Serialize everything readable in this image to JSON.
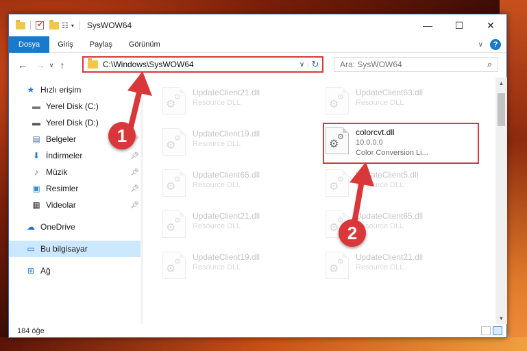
{
  "window": {
    "title": "SysWOW64",
    "controls": {
      "minimize": "—",
      "maximize": "☐",
      "close": "✕"
    }
  },
  "ribbon": {
    "tabs": [
      "Dosya",
      "Giriş",
      "Paylaş",
      "Görünüm"
    ],
    "active_tab": "Dosya",
    "help_label": "?"
  },
  "address": {
    "path": "C:\\Windows\\SysWOW64",
    "search_placeholder": "Ara: SysWOW64"
  },
  "nav": {
    "items": [
      {
        "label": "Hızlı erişim",
        "icon": "star-icon",
        "pinned": false
      },
      {
        "label": "Yerel Disk (C:)",
        "icon": "drive-icon",
        "pinned": false
      },
      {
        "label": "Yerel Disk (D:)",
        "icon": "drive-icon",
        "pinned": false
      },
      {
        "label": "Belgeler",
        "icon": "documents-icon",
        "pinned": true
      },
      {
        "label": "İndirmeler",
        "icon": "download-icon",
        "pinned": true
      },
      {
        "label": "Müzik",
        "icon": "music-icon",
        "pinned": true
      },
      {
        "label": "Resimler",
        "icon": "pictures-icon",
        "pinned": true
      },
      {
        "label": "Videolar",
        "icon": "videos-icon",
        "pinned": true
      },
      {
        "label": "OneDrive",
        "icon": "onedrive-icon",
        "pinned": false
      },
      {
        "label": "Bu bilgisayar",
        "icon": "computer-icon",
        "pinned": false
      },
      {
        "label": "Ağ",
        "icon": "network-icon",
        "pinned": false
      }
    ],
    "selected": "Bu bilgisayar"
  },
  "files": [
    {
      "name": "UpdateClient21.dll",
      "sub1": "Resource DLL",
      "sub2": "",
      "faded": true
    },
    {
      "name": "UpdateClient63.dll",
      "sub1": "Resource DLL",
      "sub2": "",
      "faded": true
    },
    {
      "name": "UpdateClient19.dll",
      "sub1": "Resource DLL",
      "sub2": "",
      "faded": true
    },
    {
      "name": "colorcvt.dll",
      "sub1": "10.0.0.0",
      "sub2": "Color Conversion Li...",
      "faded": false
    },
    {
      "name": "UpdateClient65.dll",
      "sub1": "Resource DLL",
      "sub2": "",
      "faded": true
    },
    {
      "name": "UpdateClient5.dll",
      "sub1": "Resource DLL",
      "sub2": "",
      "faded": true
    },
    {
      "name": "UpdateClient21.dll",
      "sub1": "Resource DLL",
      "sub2": "",
      "faded": true
    },
    {
      "name": "UpdateClient65.dll",
      "sub1": "Resource DLL",
      "sub2": "",
      "faded": true
    },
    {
      "name": "UpdateClient19.dll",
      "sub1": "Resource DLL",
      "sub2": "",
      "faded": true
    },
    {
      "name": "UpdateClient21.dll",
      "sub1": "Resource DLL",
      "sub2": "",
      "faded": true
    }
  ],
  "status": {
    "item_count": "184 öğe"
  },
  "annotations": {
    "step1": "1",
    "step2": "2",
    "color": "#d9373a"
  }
}
